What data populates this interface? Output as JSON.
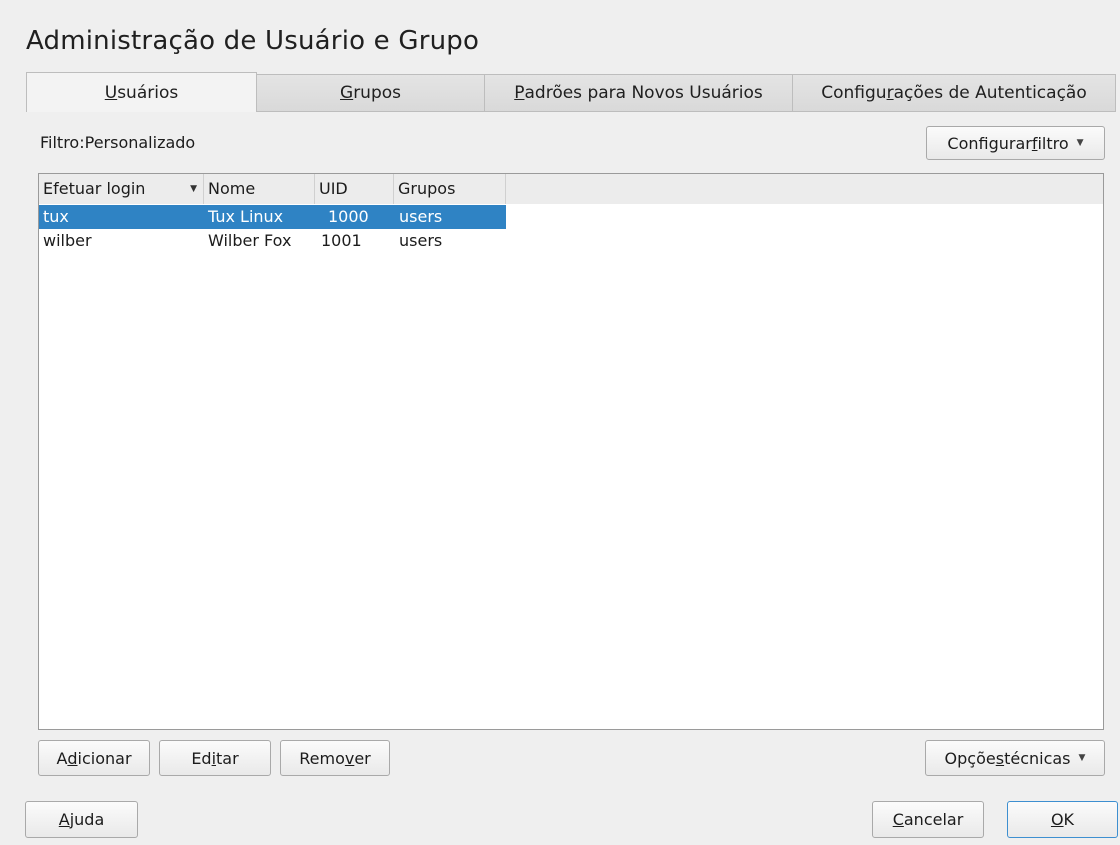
{
  "title": "Administração de Usuário e Grupo",
  "tabs": [
    {
      "pre": "",
      "mn": "U",
      "post": "suários",
      "active": true
    },
    {
      "pre": "",
      "mn": "G",
      "post": "rupos",
      "active": false
    },
    {
      "pre": "",
      "mn": "P",
      "post": "adrões para Novos Usuários",
      "active": false
    },
    {
      "pre": "Configu",
      "mn": "r",
      "post": "ações de Autenticação",
      "active": false
    }
  ],
  "filter": {
    "label": "Filtro:Personalizado"
  },
  "configure_filter": {
    "pre": "Configurar ",
    "mn": "f",
    "post": "iltro"
  },
  "table": {
    "columns": [
      "Efetuar login",
      "Nome",
      "UID",
      "Grupos"
    ],
    "rows": [
      {
        "login": "tux",
        "name": "Tux Linux",
        "uid": "1000",
        "groups": "users",
        "selected": true
      },
      {
        "login": "wilber",
        "name": "Wilber Fox",
        "uid": "1001",
        "groups": "users",
        "selected": false
      }
    ]
  },
  "actions": {
    "add": {
      "pre": "A",
      "mn": "d",
      "post": "icionar"
    },
    "edit": {
      "pre": "Ed",
      "mn": "i",
      "post": "tar"
    },
    "remove": {
      "pre": "Remo",
      "mn": "v",
      "post": "er"
    },
    "expert": {
      "pre": "Opçõe",
      "mn": "s",
      "post": " técnicas"
    }
  },
  "footer": {
    "help": {
      "pre": "",
      "mn": "A",
      "post": "juda"
    },
    "cancel": {
      "pre": "",
      "mn": "C",
      "post": "ancelar"
    },
    "ok": {
      "pre": "",
      "mn": "O",
      "post": "K"
    }
  },
  "colors": {
    "selection": "#2f83c4",
    "window": "#efefef"
  }
}
